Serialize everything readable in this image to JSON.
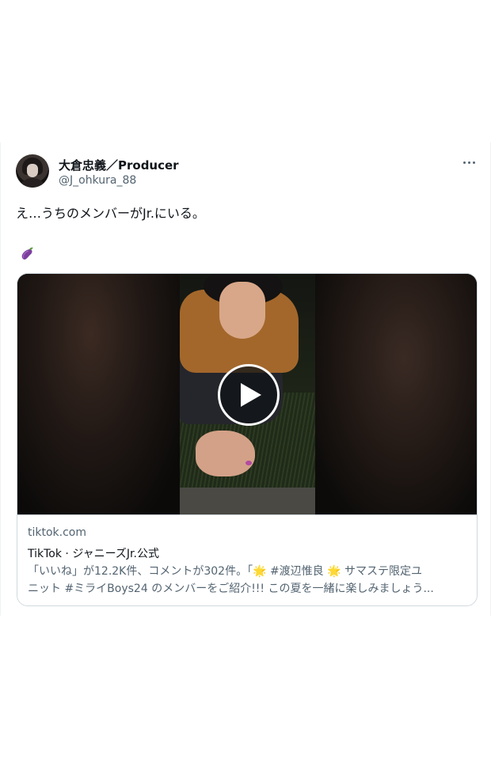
{
  "tweet": {
    "display_name": "大倉忠義／Producer",
    "handle": "@J_ohkura_88",
    "text": "え…うちのメンバーがJr.にいる。",
    "emoji": "eggplant-icon",
    "more_icon": "more-horizontal-icon"
  },
  "card": {
    "media_icon": "play-icon",
    "domain": "tiktok.com",
    "title": "TikTok · ジャニーズJr.公式",
    "description": "「いいね」が12.2K件、コメントが302件。「🌟 #渡辺惟良 🌟 サマステ限定ユ\nニット #ミライBoys24 のメンバーをご紹介!!! この夏を一緒に楽しみましょう..."
  },
  "colors": {
    "text_primary": "#0f1419",
    "text_secondary": "#536471",
    "border": "#cfd9de",
    "eggplant": "#7b3f9e"
  }
}
